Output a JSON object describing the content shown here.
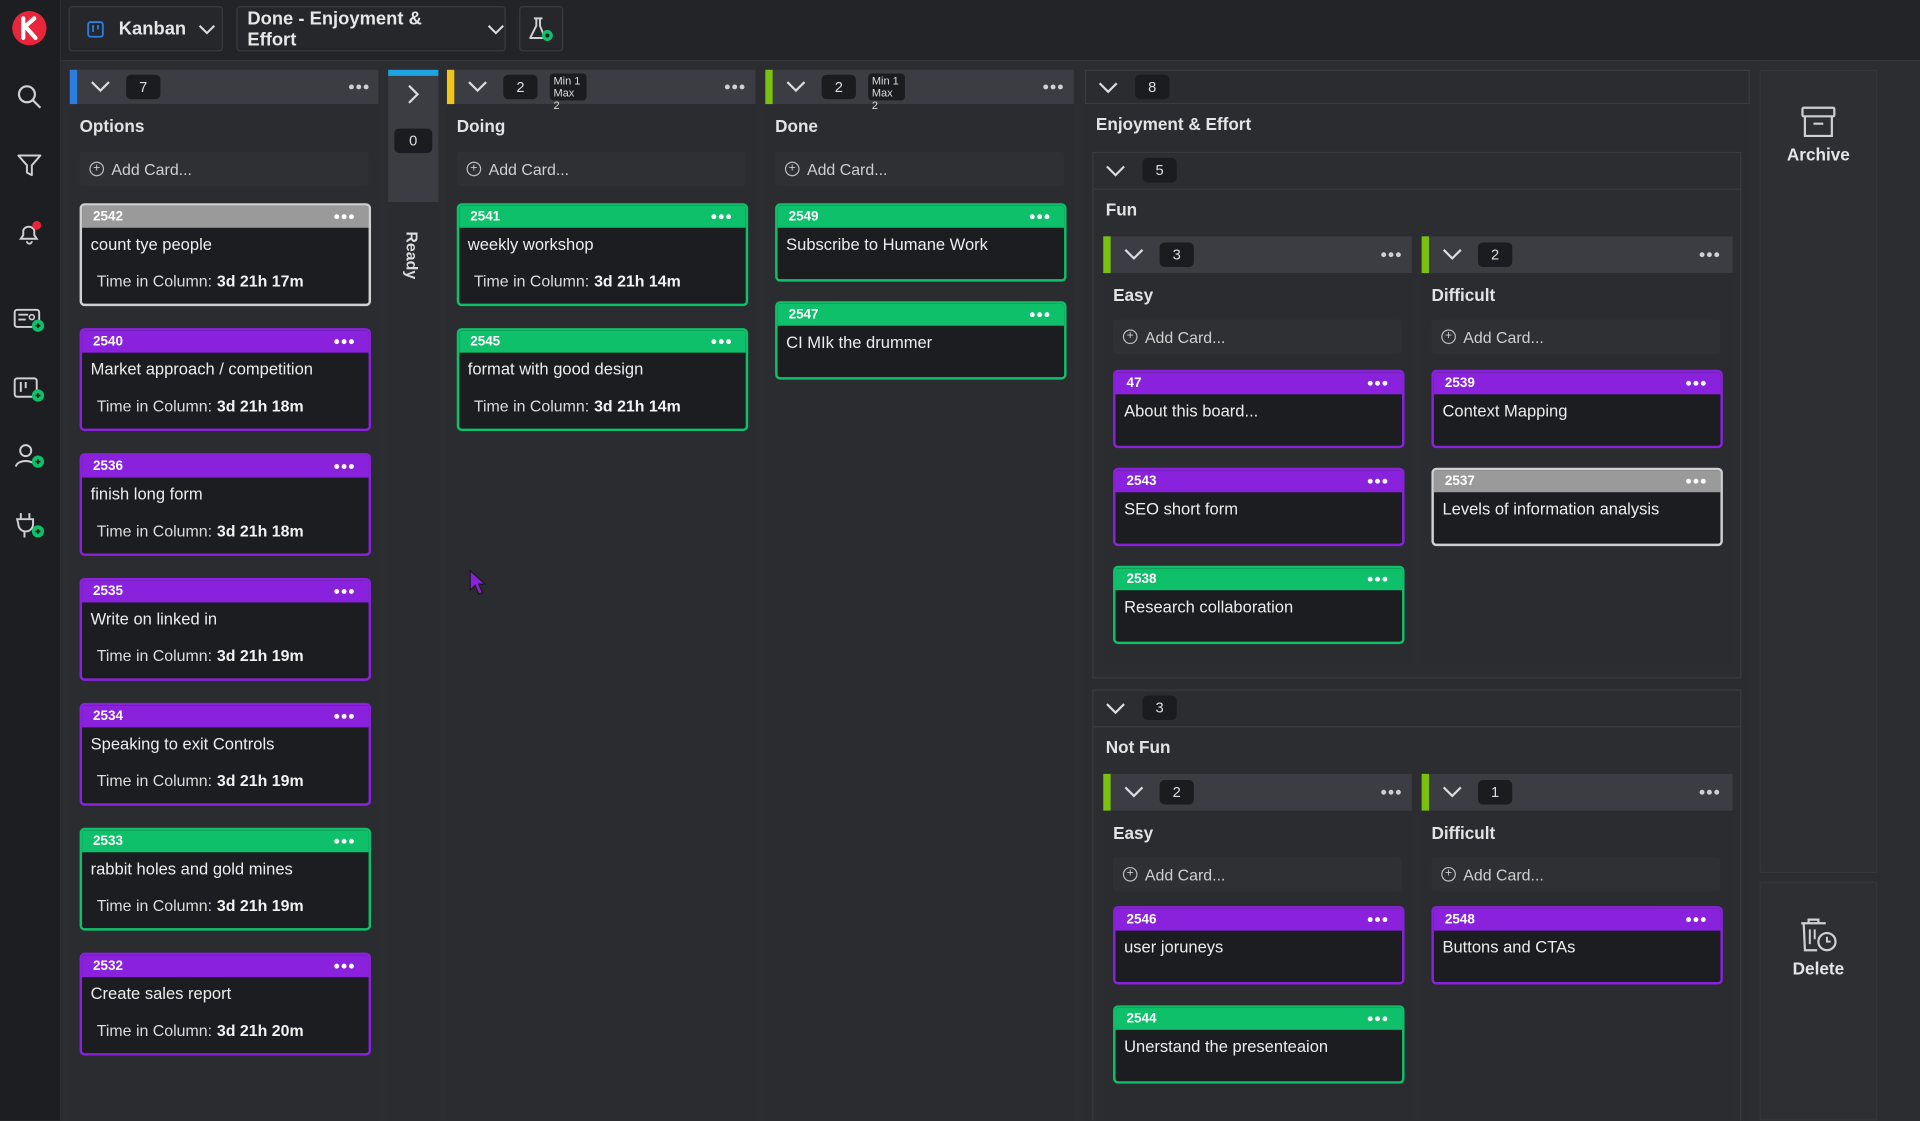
{
  "toolbar": {
    "board_type": "Kanban",
    "view_name": "Done - Enjoyment & Effort"
  },
  "sidebar": {
    "icons": [
      "kanbanize-logo-icon",
      "search-icon",
      "filter-icon",
      "notifications-icon",
      "card-settings-icon",
      "board-add-icon",
      "user-add-icon",
      "integrations-icon"
    ]
  },
  "columns": {
    "options": {
      "title": "Options",
      "count": "7",
      "add_label": "Add Card..."
    },
    "ready": {
      "title": "Ready",
      "count": "0"
    },
    "doing": {
      "title": "Doing",
      "count": "2",
      "min": "Min 1",
      "max": "Max 2",
      "add_label": "Add Card..."
    },
    "done": {
      "title": "Done",
      "count": "2",
      "min": "Min 1",
      "max": "Max 2",
      "add_label": "Add Card..."
    },
    "ee": {
      "title": "Enjoyment & Effort",
      "count": "8",
      "fun": {
        "title": "Fun",
        "count": "5",
        "easy": {
          "title": "Easy",
          "count": "3",
          "add_label": "Add Card..."
        },
        "difficult": {
          "title": "Difficult",
          "count": "2",
          "add_label": "Add Card..."
        }
      },
      "notfun": {
        "title": "Not Fun",
        "count": "3",
        "easy": {
          "title": "Easy",
          "count": "2",
          "add_label": "Add Card..."
        },
        "difficult": {
          "title": "Difficult",
          "count": "1",
          "add_label": "Add Card..."
        }
      }
    }
  },
  "time_label": "Time in Column:",
  "cards": {
    "options": [
      {
        "id": "2542",
        "title": "count tye people",
        "time": "3d 21h 17m",
        "color": "grey"
      },
      {
        "id": "2540",
        "title": "Market approach / competition",
        "time": "3d 21h 18m",
        "color": "purple"
      },
      {
        "id": "2536",
        "title": "finish long form",
        "time": "3d 21h 18m",
        "color": "purple"
      },
      {
        "id": "2535",
        "title": "Write on linked in",
        "time": "3d 21h 19m",
        "color": "purple"
      },
      {
        "id": "2534",
        "title": "Speaking to exit Controls",
        "time": "3d 21h 19m",
        "color": "purple"
      },
      {
        "id": "2533",
        "title": "rabbit holes and gold mines",
        "time": "3d 21h 19m",
        "color": "green"
      },
      {
        "id": "2532",
        "title": "Create sales report",
        "time": "3d 21h 20m",
        "color": "purple"
      }
    ],
    "doing": [
      {
        "id": "2541",
        "title": "weekly workshop",
        "time": "3d 21h 14m",
        "color": "green"
      },
      {
        "id": "2545",
        "title": "format with good design",
        "time": "3d 21h 14m",
        "color": "green"
      }
    ],
    "done": [
      {
        "id": "2549",
        "title": "Subscribe to Humane Work",
        "color": "green"
      },
      {
        "id": "2547",
        "title": "CI MIk the drummer",
        "color": "green"
      }
    ],
    "fun_easy": [
      {
        "id": "47",
        "title": "About this board...",
        "color": "purple"
      },
      {
        "id": "2543",
        "title": "SEO short form",
        "color": "purple"
      },
      {
        "id": "2538",
        "title": "Research collaboration",
        "color": "green"
      }
    ],
    "fun_difficult": [
      {
        "id": "2539",
        "title": "Context Mapping",
        "color": "purple"
      },
      {
        "id": "2537",
        "title": "Levels of information analysis",
        "color": "grey"
      }
    ],
    "notfun_easy": [
      {
        "id": "2546",
        "title": "user joruneys",
        "color": "purple"
      },
      {
        "id": "2544",
        "title": "Unerstand the presenteaion",
        "color": "green"
      }
    ],
    "notfun_difficult": [
      {
        "id": "2548",
        "title": "Buttons and CTAs",
        "color": "purple"
      }
    ]
  },
  "right_panel": {
    "archive_label": "Archive",
    "delete_label": "Delete"
  },
  "colors": {
    "purple": "#8a22dd",
    "green": "#0ec06a",
    "grey": "#9a9a9a",
    "accent_blue": "#2b7de0",
    "accent_yellow": "#f0c419",
    "accent_lime": "#7ac10f",
    "logo_red": "#e8263b"
  }
}
